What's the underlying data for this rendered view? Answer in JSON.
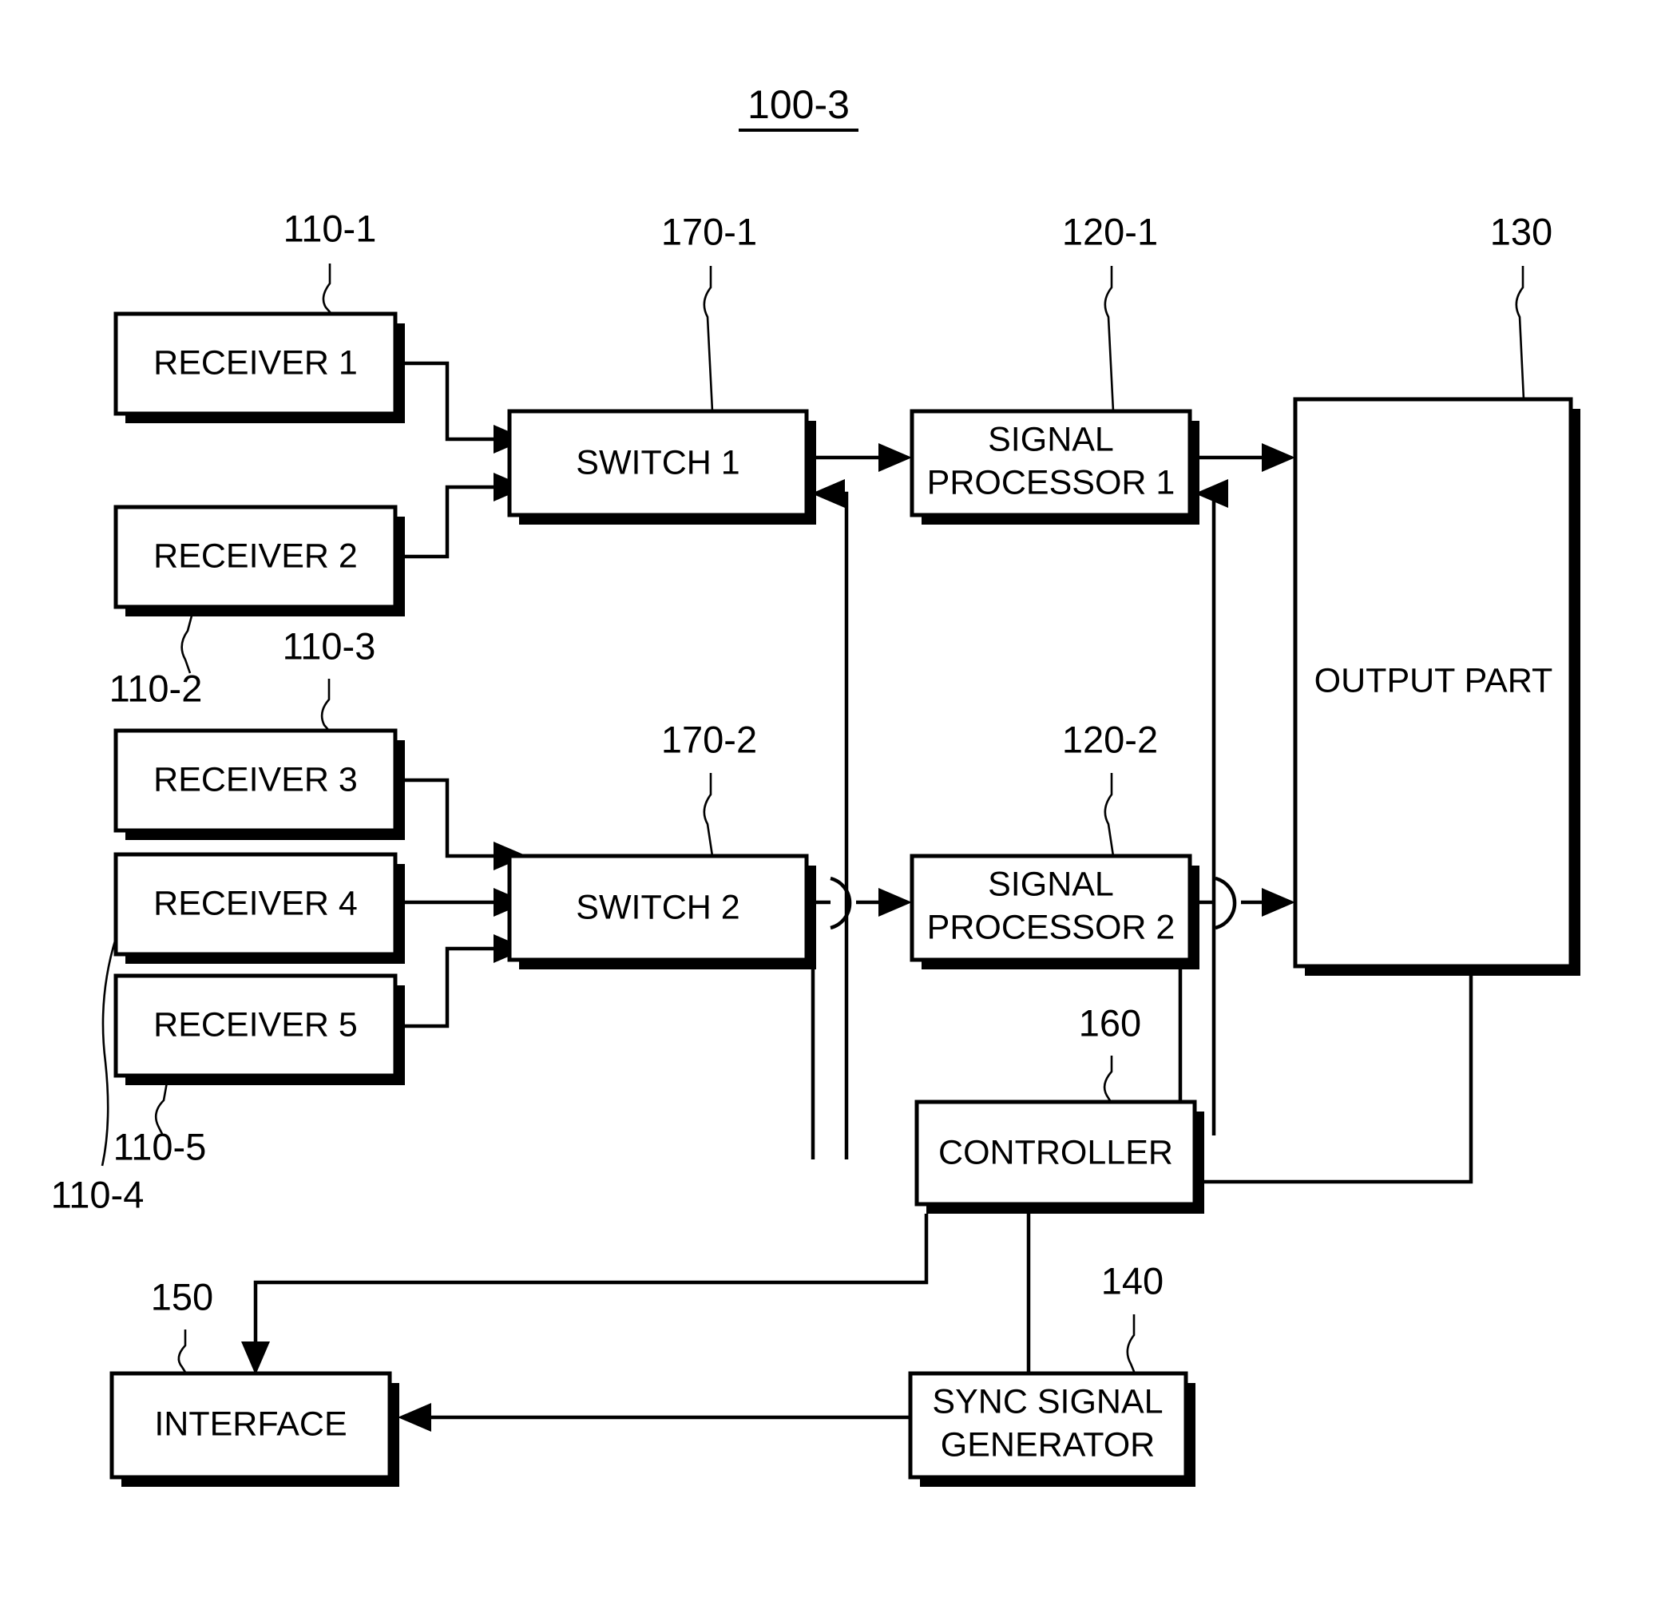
{
  "figure": {
    "title": "100-3",
    "title_underlined": true,
    "background_color": "#ffffff",
    "line_color": "#000000"
  },
  "blocks": {
    "receiver_1": {
      "label": "RECEIVER 1",
      "ref": "110-1"
    },
    "receiver_2": {
      "label": "RECEIVER 2",
      "ref": "110-2"
    },
    "receiver_3": {
      "label": "RECEIVER 3",
      "ref": "110-3"
    },
    "receiver_4": {
      "label": "RECEIVER 4",
      "ref": "110-4"
    },
    "receiver_5": {
      "label": "RECEIVER 5",
      "ref": "110-5"
    },
    "switch_1": {
      "label": "SWITCH 1",
      "ref": "170-1"
    },
    "switch_2": {
      "label": "SWITCH 2",
      "ref": "170-2"
    },
    "signal_processor_1": {
      "label_line1": "SIGNAL",
      "label_line2": "PROCESSOR 1",
      "ref": "120-1"
    },
    "signal_processor_2": {
      "label_line1": "SIGNAL",
      "label_line2": "PROCESSOR 2",
      "ref": "120-2"
    },
    "output_part": {
      "label": "OUTPUT PART",
      "ref": "130"
    },
    "controller": {
      "label": "CONTROLLER",
      "ref": "160"
    },
    "sync_signal_generator": {
      "label_line1": "SYNC SIGNAL",
      "label_line2": "GENERATOR",
      "ref": "140"
    },
    "interface": {
      "label": "INTERFACE",
      "ref": "150"
    }
  },
  "reference_numerals": [
    "100-3",
    "110-1",
    "110-2",
    "110-3",
    "110-4",
    "110-5",
    "170-1",
    "170-2",
    "120-1",
    "120-2",
    "130",
    "160",
    "140",
    "150"
  ],
  "connections": [
    {
      "from": "receiver_1",
      "to": "switch_1",
      "style": "arrow"
    },
    {
      "from": "receiver_2",
      "to": "switch_1",
      "style": "arrow"
    },
    {
      "from": "receiver_3",
      "to": "switch_2",
      "style": "arrow"
    },
    {
      "from": "receiver_4",
      "to": "switch_2",
      "style": "arrow"
    },
    {
      "from": "receiver_5",
      "to": "switch_2",
      "style": "arrow"
    },
    {
      "from": "switch_1",
      "to": "signal_processor_1",
      "style": "arrow"
    },
    {
      "from": "switch_2",
      "to": "signal_processor_2",
      "style": "arrow"
    },
    {
      "from": "signal_processor_1",
      "to": "output_part",
      "style": "arrow"
    },
    {
      "from": "signal_processor_2",
      "to": "output_part",
      "style": "arrow"
    },
    {
      "from": "controller",
      "to": "switch_1",
      "style": "arrow"
    },
    {
      "from": "controller",
      "to": "switch_2",
      "style": "arrow"
    },
    {
      "from": "controller",
      "to": "signal_processor_1",
      "style": "arrow"
    },
    {
      "from": "controller",
      "to": "signal_processor_2",
      "style": "arrow"
    },
    {
      "from": "controller",
      "to": "output_part",
      "style": "arrow"
    },
    {
      "from": "controller",
      "to": "interface",
      "style": "arrow"
    },
    {
      "from": "sync_signal_generator",
      "to": "controller",
      "style": "arrow"
    },
    {
      "from": "controller",
      "to": "sync_signal_generator",
      "style": "arrow"
    },
    {
      "from": "sync_signal_generator",
      "to": "interface",
      "style": "arrow"
    }
  ]
}
